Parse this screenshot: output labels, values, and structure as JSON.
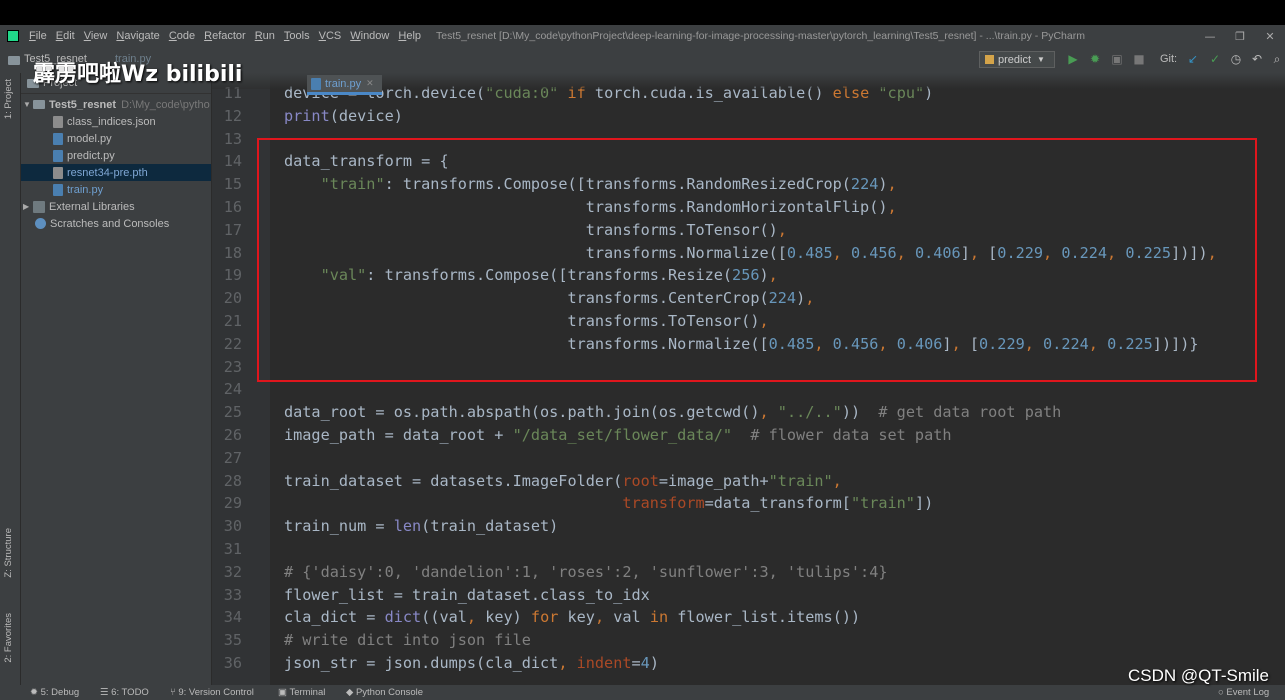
{
  "window": {
    "title": "Test5_resnet [D:\\My_code\\pythonProject\\deep-learning-for-image-processing-master\\pytorch_learning\\Test5_resnet] - ...\\train.py - PyCharm"
  },
  "menu": [
    "File",
    "Edit",
    "View",
    "Navigate",
    "Code",
    "Refactor",
    "Run",
    "Tools",
    "VCS",
    "Window",
    "Help"
  ],
  "navbar": {
    "crumb_project": "Test5_resnet",
    "crumb_file": "train.py",
    "run_config": "predict",
    "git_label": "Git:"
  },
  "side_tabs": {
    "project": "1: Project",
    "structure": "Z: Structure",
    "favorites": "2: Favorites"
  },
  "project_panel": {
    "header": "Project",
    "root": {
      "name": "Test5_resnet",
      "path": "D:\\My_code\\pytho"
    },
    "files": [
      "class_indices.json",
      "model.py",
      "predict.py",
      "resnet34-pre.pth",
      "train.py"
    ],
    "selected_file": "resnet34-pre.pth",
    "extra": [
      "External Libraries",
      "Scratches and Consoles"
    ]
  },
  "editor": {
    "tab_label": "train.py"
  },
  "code_lines": [
    {
      "n": "11",
      "t": "device = torch.device(\"cuda:0\" if torch.cuda.is_available() else \"cpu\")"
    },
    {
      "n": "12",
      "t": "print(device)"
    },
    {
      "n": "13",
      "t": ""
    },
    {
      "n": "14",
      "t": "data_transform = {"
    },
    {
      "n": "15",
      "t": "    \"train\": transforms.Compose([transforms.RandomResizedCrop(224),"
    },
    {
      "n": "16",
      "t": "                                 transforms.RandomHorizontalFlip(),"
    },
    {
      "n": "17",
      "t": "                                 transforms.ToTensor(),"
    },
    {
      "n": "18",
      "t": "                                 transforms.Normalize([0.485, 0.456, 0.406], [0.229, 0.224, 0.225])]),"
    },
    {
      "n": "19",
      "t": "    \"val\": transforms.Compose([transforms.Resize(256),"
    },
    {
      "n": "20",
      "t": "                               transforms.CenterCrop(224),"
    },
    {
      "n": "21",
      "t": "                               transforms.ToTensor(),"
    },
    {
      "n": "22",
      "t": "                               transforms.Normalize([0.485, 0.456, 0.406], [0.229, 0.224, 0.225])])}"
    },
    {
      "n": "23",
      "t": ""
    },
    {
      "n": "24",
      "t": ""
    },
    {
      "n": "25",
      "t": "data_root = os.path.abspath(os.path.join(os.getcwd(), \"../..\"))  # get data root path"
    },
    {
      "n": "26",
      "t": "image_path = data_root + \"/data_set/flower_data/\"  # flower data set path"
    },
    {
      "n": "27",
      "t": ""
    },
    {
      "n": "28",
      "t": "train_dataset = datasets.ImageFolder(root=image_path+\"train\","
    },
    {
      "n": "29",
      "t": "                                     transform=data_transform[\"train\"])"
    },
    {
      "n": "30",
      "t": "train_num = len(train_dataset)"
    },
    {
      "n": "31",
      "t": ""
    },
    {
      "n": "32",
      "t": "# {'daisy':0, 'dandelion':1, 'roses':2, 'sunflower':3, 'tulips':4}"
    },
    {
      "n": "33",
      "t": "flower_list = train_dataset.class_to_idx"
    },
    {
      "n": "34",
      "t": "cla_dict = dict((val, key) for key, val in flower_list.items())"
    },
    {
      "n": "35",
      "t": "# write dict into json file"
    },
    {
      "n": "36",
      "t": "json_str = json.dumps(cla_dict, indent=4)"
    }
  ],
  "bottom_tools": [
    "5: Debug",
    "6: TODO",
    "9: Version Control",
    "Terminal",
    "Python Console",
    "Event Log"
  ],
  "watermarks": {
    "bilibili": "霹雳吧啦Wz bilibili",
    "csdn": "CSDN @QT-Smile"
  },
  "colors": {
    "keyword": "#cc7832",
    "string": "#6a8759",
    "number": "#6897bb",
    "comment": "#808080",
    "builtin": "#8888c6",
    "kwarg": "#aa4926",
    "text": "#a9b7c6",
    "highlight_box": "#e0161d"
  }
}
